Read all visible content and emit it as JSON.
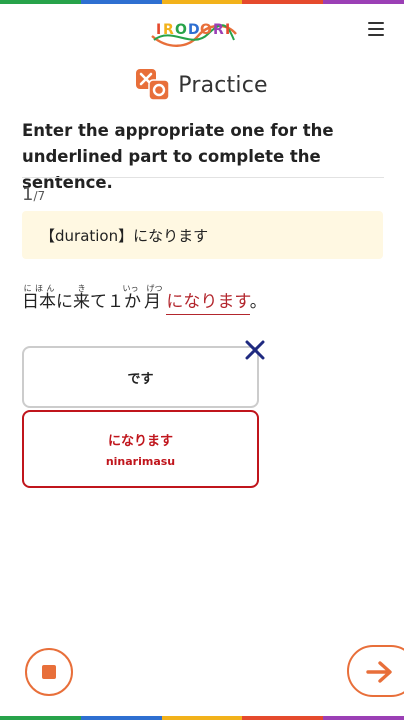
{
  "app": {
    "logo_text": "IRODORI"
  },
  "header": {
    "menu_icon": "hamburger-menu-icon"
  },
  "page": {
    "title": "Practice",
    "title_icon": "practice-x-o-icon"
  },
  "instruction": "Enter the appropriate one for the underlined part to complete the sentence.",
  "progress": {
    "current": "1",
    "total": "/7"
  },
  "hint": "【duration】になります",
  "sentence": {
    "segments": [
      {
        "base": "日本",
        "ruby": "にほん"
      },
      {
        "text": "に"
      },
      {
        "base": "来",
        "ruby": "き"
      },
      {
        "text": "て１"
      },
      {
        "base": "か月",
        "ruby": "いっ　げつ"
      }
    ],
    "underlined": "になります",
    "end": "。"
  },
  "choices": [
    {
      "label": "です",
      "romaji": "",
      "state": "wrong"
    },
    {
      "label": "になります",
      "romaji": "ninarimasu",
      "state": "correct"
    }
  ],
  "controls": {
    "stop_icon": "stop-icon",
    "next_icon": "arrow-right-icon"
  },
  "colors": {
    "accent": "#e86f3a",
    "correct": "#c0151c",
    "wrong_mark": "#1f2a80",
    "hint_bg": "#fff8e2",
    "rainbow": [
      "#27a34a",
      "#2e6fd1",
      "#f2b21b",
      "#e54a2d",
      "#9b3fb5"
    ]
  }
}
